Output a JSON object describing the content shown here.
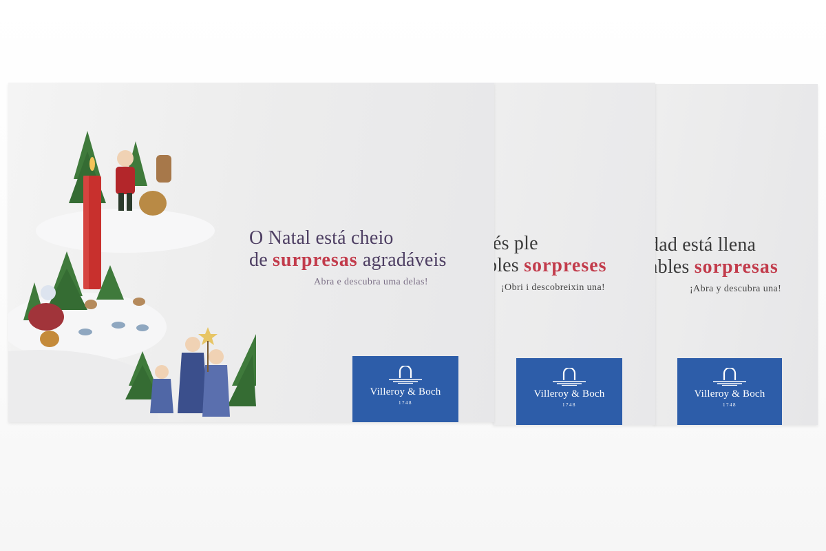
{
  "cards": {
    "pt": {
      "headline_line1": "O Natal está cheio",
      "headline_line2_prefix": "de ",
      "headline_highlight": "surpresas",
      "headline_line2_suffix": " agradáveis",
      "subline": "Abra e descubra uma delas!"
    },
    "ca": {
      "headline_line1": "és ple",
      "headline_line2_prefix": "bles ",
      "headline_highlight": "sorpreses",
      "subline": "¡Obri i descobreixin una!"
    },
    "es": {
      "headline_line1": "dad está llena",
      "headline_line2_prefix": "ables ",
      "headline_highlight": "sorpresas",
      "subline": "¡Abra y descubra una!"
    }
  },
  "logo": {
    "brand": "Villeroy & Boch",
    "year": "1748",
    "background_color": "#2d5da9"
  },
  "colors": {
    "highlight": "#c23b4b",
    "headline": "#4e3f63",
    "candle": "#c8302d",
    "tree": "#3f7a3b"
  },
  "icons": [
    "christmas-figurine-scene",
    "villeroy-boch-logo-icon"
  ]
}
